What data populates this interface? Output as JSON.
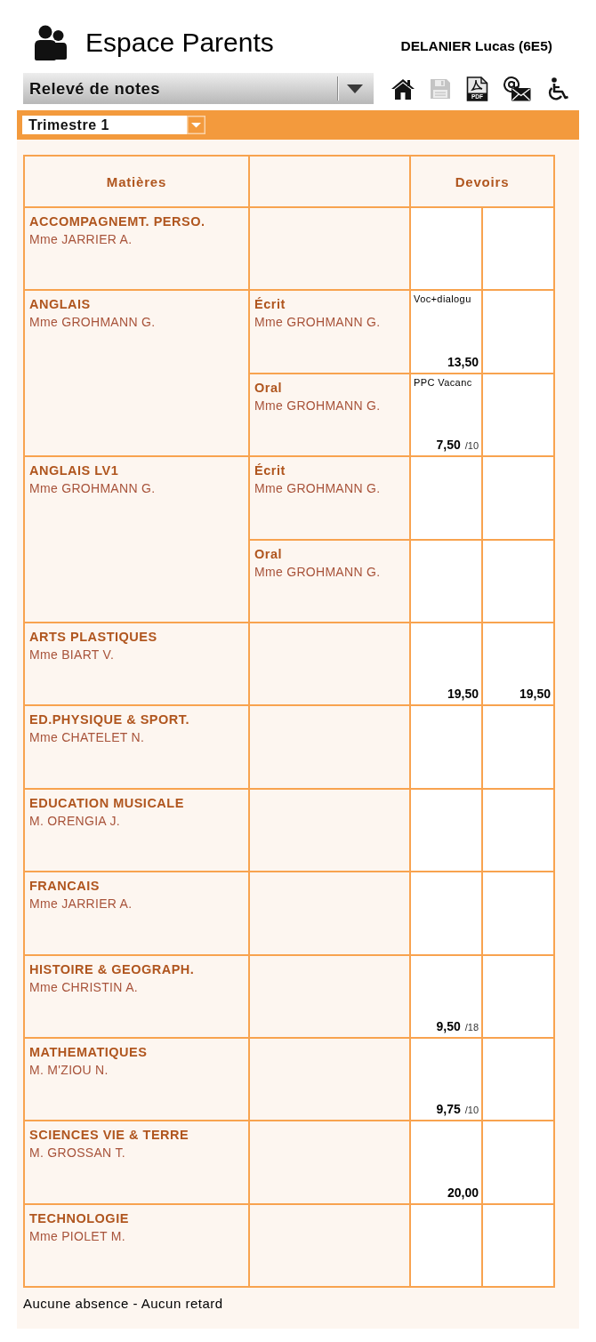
{
  "header": {
    "title": "Espace Parents",
    "student": "DELANIER Lucas (6E5)"
  },
  "toolbar": {
    "view_select": {
      "value": "Relevé de notes"
    },
    "actions": [
      {
        "kind": "home",
        "disabled": false
      },
      {
        "kind": "save",
        "disabled": true
      },
      {
        "kind": "pdf",
        "disabled": false,
        "label": "PDF"
      },
      {
        "kind": "email",
        "disabled": false
      },
      {
        "kind": "accessibility",
        "disabled": false
      }
    ]
  },
  "period_select": {
    "value": "Trimestre 1"
  },
  "table": {
    "subjects_heading": "Matières",
    "assignments_heading": "Devoirs",
    "subjects": [
      {
        "name": "ACCOMPAGNEMT. PERSO.",
        "teacher": "Mme JARRIER A."
      },
      {
        "name": "ANGLAIS",
        "teacher": "Mme GROHMANN G.",
        "components": [
          {
            "name": "Écrit",
            "teacher": "Mme GROHMANN G.",
            "grades": [
              {
                "label": "Voc+dialogu",
                "value": "13,50"
              }
            ]
          },
          {
            "name": "Oral",
            "teacher": "Mme GROHMANN G.",
            "grades": [
              {
                "label": "PPC Vacanc",
                "value": "7,50",
                "scale": "/10"
              }
            ]
          }
        ]
      },
      {
        "name": "ANGLAIS LV1",
        "teacher": "Mme GROHMANN G.",
        "components": [
          {
            "name": "Écrit",
            "teacher": "Mme GROHMANN G."
          },
          {
            "name": "Oral",
            "teacher": "Mme GROHMANN G."
          }
        ]
      },
      {
        "name": "ARTS PLASTIQUES",
        "teacher": "Mme BIART V.",
        "grades": [
          {
            "value": "19,50"
          },
          {
            "value": "19,50"
          }
        ]
      },
      {
        "name": "ED.PHYSIQUE & SPORT.",
        "teacher": "Mme CHATELET N."
      },
      {
        "name": "EDUCATION MUSICALE",
        "teacher": "M. ORENGIA J."
      },
      {
        "name": "FRANCAIS",
        "teacher": "Mme JARRIER A."
      },
      {
        "name": "HISTOIRE & GEOGRAPH.",
        "teacher": "Mme CHRISTIN A.",
        "grades": [
          {
            "value": "9,50",
            "scale": "/18"
          }
        ]
      },
      {
        "name": "MATHEMATIQUES",
        "teacher": "M. M'ZIOU N.",
        "grades": [
          {
            "value": "9,75",
            "scale": "/10"
          }
        ]
      },
      {
        "name": "SCIENCES VIE & TERRE",
        "teacher": "M. GROSSAN T.",
        "grades": [
          {
            "value": "20,00"
          }
        ]
      },
      {
        "name": "TECHNOLOGIE",
        "teacher": "Mme PIOLET M."
      }
    ]
  },
  "footer": {
    "attendance": "Aucune absence - Aucun retard"
  }
}
